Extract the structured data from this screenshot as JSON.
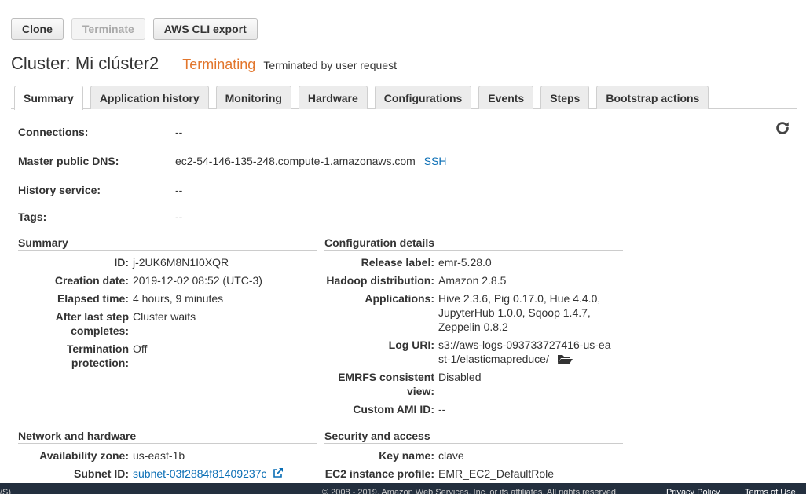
{
  "toolbar": {
    "clone": "Clone",
    "terminate": "Terminate",
    "cli_export": "AWS CLI export"
  },
  "header": {
    "title": "Cluster: Mi clúster2",
    "state": "Terminating",
    "state_reason": "Terminated by user request"
  },
  "tabs": [
    "Summary",
    "Application history",
    "Monitoring",
    "Hardware",
    "Configurations",
    "Events",
    "Steps",
    "Bootstrap actions"
  ],
  "connections": {
    "connections_label": "Connections:",
    "connections_value": "--",
    "dns_label": "Master public DNS:",
    "dns_value": "ec2-54-146-135-248.compute-1.amazonaws.com",
    "ssh_link": "SSH",
    "history_label": "History service:",
    "history_value": "--",
    "tags_label": "Tags:",
    "tags_value": "--"
  },
  "summary": {
    "title": "Summary",
    "rows": [
      {
        "label": "ID:",
        "value": "j-2UK6M8N1I0XQR"
      },
      {
        "label": "Creation date:",
        "value": "2019-12-02 08:52 (UTC-3)"
      },
      {
        "label": "Elapsed time:",
        "value": "4 hours, 9 minutes"
      },
      {
        "label": "After last step completes:",
        "value": "Cluster waits"
      },
      {
        "label": "Termination protection:",
        "value": "Off"
      }
    ]
  },
  "config": {
    "title": "Configuration details",
    "rows": [
      {
        "label": "Release label:",
        "value": "emr-5.28.0"
      },
      {
        "label": "Hadoop distribution:",
        "value": "Amazon 2.8.5"
      },
      {
        "label": "Applications:",
        "value": "Hive 2.3.6, Pig 0.17.0, Hue 4.4.0, JupyterHub 1.0.0, Sqoop 1.4.7, Zeppelin 0.8.2"
      },
      {
        "label": "Log URI:",
        "value": "s3://aws-logs-093733727416-us-east-1/elasticmapreduce/"
      },
      {
        "label": "EMRFS consistent view:",
        "value": "Disabled"
      },
      {
        "label": "Custom AMI ID:",
        "value": "--"
      }
    ]
  },
  "network": {
    "title": "Network and hardware",
    "az_label": "Availability zone:",
    "az_value": "us-east-1b",
    "subnet_label": "Subnet ID:",
    "subnet_value": "subnet-03f2884f81409237c"
  },
  "security": {
    "title": "Security and access",
    "key_label": "Key name:",
    "key_value": "clave",
    "profile_label": "EC2 instance profile:",
    "profile_value": "EMR_EC2_DefaultRole"
  },
  "footer": {
    "left": "/S)",
    "copyright": "© 2008 - 2019, Amazon Web Services, Inc. or its affiliates. All rights reserved.",
    "privacy": "Privacy Policy",
    "terms": "Terms of Use"
  }
}
